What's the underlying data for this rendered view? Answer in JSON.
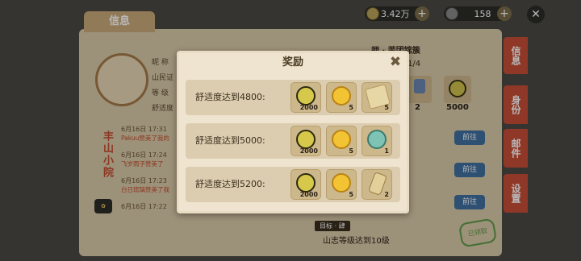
{
  "top_bar": {
    "currency1_value": "3.42万",
    "currency2_value": "158"
  },
  "info_panel": {
    "tab_title": "信息",
    "profile_labels": [
      "昵  称",
      "山民证",
      "等  级",
      "舒适度"
    ],
    "name_vertical": "丰山小院",
    "logs": [
      {
        "date": "6月16日 17:31",
        "text": "Pakuu赞美了我的"
      },
      {
        "date": "6月16日 17:24",
        "text": "飞岁雨子赞美了"
      },
      {
        "date": "6月16日 17:23",
        "text": "白日琉璃赞美了我"
      },
      {
        "date": "6月16日 17:22",
        "text": ""
      }
    ],
    "garden_title": "拥 · 茉团锦簇",
    "progress": "1/4",
    "right_items": [
      {
        "qty": "2"
      },
      {
        "qty": "5000"
      }
    ],
    "goto_buttons": [
      "前往",
      "前往",
      "前往"
    ],
    "goal_label": "目标 · 肆",
    "goal_text": "山志等级达到10级",
    "side_tabs": [
      "信息",
      "身份",
      "邮件",
      "设置"
    ],
    "badge": "已领取"
  },
  "modal": {
    "title": "奖励",
    "rows": [
      {
        "requirement": "舒适度达到4800:",
        "rewards": [
          {
            "icon": "jade-coin-icon",
            "qty": "2000"
          },
          {
            "icon": "gold-coin-icon",
            "qty": "5"
          },
          {
            "icon": "scroll-map-icon",
            "qty": "5"
          }
        ]
      },
      {
        "requirement": "舒适度达到5000:",
        "rewards": [
          {
            "icon": "jade-coin-icon",
            "qty": "2000"
          },
          {
            "icon": "gold-coin-icon",
            "qty": "5"
          },
          {
            "icon": "teal-bowl-icon",
            "qty": "1"
          }
        ]
      },
      {
        "requirement": "舒适度达到5200:",
        "rewards": [
          {
            "icon": "jade-coin-icon",
            "qty": "2000"
          },
          {
            "icon": "gold-coin-icon",
            "qty": "5"
          },
          {
            "icon": "scroll-roll-icon",
            "qty": "2"
          }
        ]
      }
    ]
  },
  "colors": {
    "modal_bg": "#efe4cf",
    "row_bg": "#dccdb0",
    "accent_red": "#c84e37",
    "button_blue": "#3f6fa0"
  }
}
